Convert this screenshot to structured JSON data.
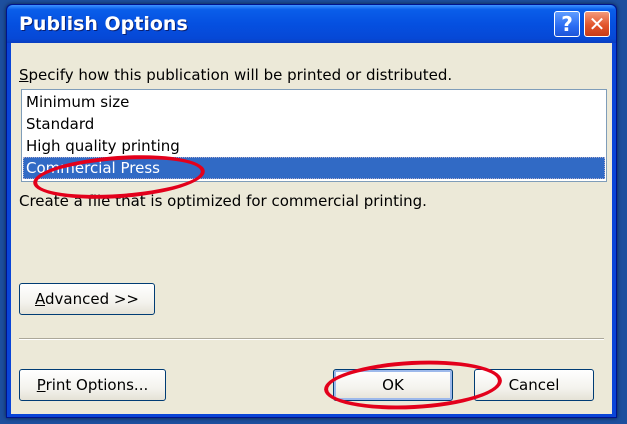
{
  "window": {
    "title": "Publish Options",
    "help_glyph": "?",
    "close_glyph": "✕"
  },
  "instruction": {
    "mnemonic": "S",
    "rest": "pecify how this publication will be printed or distributed."
  },
  "list": {
    "items": [
      {
        "label": "Minimum size",
        "selected": false
      },
      {
        "label": "Standard",
        "selected": false
      },
      {
        "label": "High quality printing",
        "selected": false
      },
      {
        "label": "Commercial Press",
        "selected": true
      }
    ]
  },
  "description": "Create a file that is optimized for commercial printing.",
  "buttons": {
    "advanced": {
      "mnemonic": "A",
      "rest": "dvanced >>"
    },
    "print_options": {
      "mnemonic": "P",
      "rest": "rint Options..."
    },
    "ok": "OK",
    "cancel": "Cancel"
  },
  "colors": {
    "title_bar": "#0550e0",
    "selection": "#316ac5",
    "annotation": "#e3001b",
    "dialog_body": "#ece9d8"
  },
  "icons": [
    "help-icon",
    "close-icon"
  ]
}
